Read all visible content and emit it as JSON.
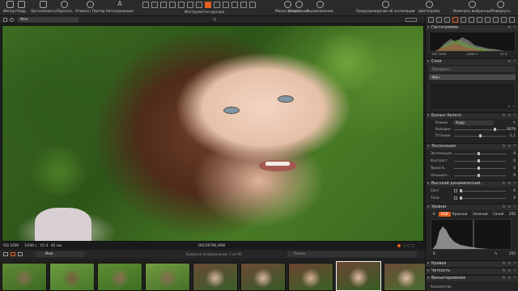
{
  "toolbar": {
    "import": "Импорт",
    "capture": "Кадр",
    "organize": "Организовать",
    "reset": "Сбросить",
    "undo_redo": "Отмена / Повтор",
    "autocorrect": "Автокоррекция",
    "cursor_tools": "Инструменты курсора",
    "focus_mask": "Маска фокуса",
    "annotations": "Аннотации",
    "alignment": "Выравнивание",
    "exposure_warning": "Предупреждение об экспозиции",
    "color_picker": "Цветопроба",
    "edit_selected": "Изменить выбранные",
    "rotate": "Повернуть"
  },
  "viewer": {
    "layer_label": "Фон",
    "iso": "ISO 1600",
    "shutter": "1/640 с",
    "aperture": "f/1.4",
    "focal": "85 мм",
    "filename": "DSC09796.ARW"
  },
  "filmstrip": {
    "sort_label": "Имя",
    "selection_text": "Выбрано изображений: 1 из 95",
    "search_placeholder": "Поиск",
    "thumbnails": [
      {
        "colors": [
          "#3d6a24",
          "#5d8a35",
          "#8a6a50"
        ]
      },
      {
        "colors": [
          "#4a7a2a",
          "#6b9a3f",
          "#7c5a3e"
        ]
      },
      {
        "colors": [
          "#3e6e22",
          "#5f8e34",
          "#8e6c54"
        ]
      },
      {
        "colors": [
          "#456f27",
          "#739c43",
          "#8a6a52"
        ]
      },
      {
        "colors": [
          "#3a5e2a",
          "#6a4a35",
          "#d8b6a0"
        ]
      },
      {
        "colors": [
          "#385a27",
          "#6e4a34",
          "#dcb9a2"
        ]
      },
      {
        "colors": [
          "#3c6226",
          "#6a4330",
          "#d9b49c"
        ]
      },
      {
        "colors": [
          "#375c24",
          "#6c4634",
          "#e0bba3"
        ]
      },
      {
        "colors": [
          "#4a7030",
          "#6a4a36",
          "#e2bfa8"
        ]
      }
    ]
  },
  "panel": {
    "histogram": {
      "title": "Гистограмма",
      "iso": "ISO 1600",
      "shutter": "1/640 с",
      "aperture": "f/1.4"
    },
    "layers": {
      "title": "Слои",
      "opacity_label": "Прозрачн...",
      "background_layer": "Фон"
    },
    "white_balance": {
      "title": "Баланс белого",
      "mode_label": "Режим",
      "mode_value": "Кадр",
      "kelvin_label": "Кельвин",
      "kelvin_value": "6078",
      "tint_label": "Оттенок",
      "tint_value": "-1,1"
    },
    "exposure": {
      "title": "Экспозиция",
      "rows": [
        {
          "label": "Экспозиция",
          "value": "0"
        },
        {
          "label": "Контраст",
          "value": "0"
        },
        {
          "label": "Яркость",
          "value": "0"
        },
        {
          "label": "Насыщен...",
          "value": "0"
        }
      ]
    },
    "hdr": {
      "title": "Высокий динамический...",
      "rows": [
        {
          "label": "Свет",
          "value": "0"
        },
        {
          "label": "Тени",
          "value": "0"
        }
      ]
    },
    "levels": {
      "title": "Уровни",
      "black": "0",
      "white": "255",
      "channels": [
        "RGB",
        "Красный",
        "Зеленый",
        "Синий"
      ],
      "out_black": "0",
      "out_white": "255"
    },
    "curve": {
      "title": "Кривая"
    },
    "sharpness": {
      "title": "Четкость"
    },
    "vignetting": {
      "title": "Виньетирование"
    },
    "quantity": {
      "title": "Количество"
    }
  },
  "colors": {
    "accent": "#e1601f",
    "panel_bg": "#242424",
    "toolbar_bg": "#2b2b2b"
  }
}
